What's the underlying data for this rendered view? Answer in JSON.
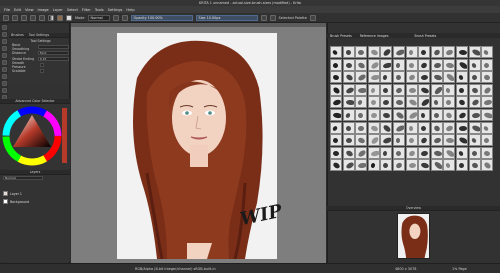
{
  "window": {
    "title": "KRITA 1 unnamed - actual-size-brush-sizes (modified) - Krita"
  },
  "menubar": {
    "items": [
      "File",
      "Edit",
      "View",
      "Image",
      "Layer",
      "Select",
      "Filter",
      "Tools",
      "Settings",
      "Help"
    ]
  },
  "toolbar": {
    "mode_label": "Mode",
    "mode_value": "Normal",
    "opacity_label": "Opacity",
    "opacity_value": "100.00%",
    "size_label": "Size",
    "size_value": "10.00px",
    "palette_label": "Selected Palette"
  },
  "tool_options": {
    "tabs": [
      "Brushes",
      "Tool Settings"
    ],
    "tab2": "Tool Settings",
    "rows": [
      {
        "label": "Basic Smoothing",
        "value": ""
      },
      {
        "label": "Distance",
        "value": "50.0"
      },
      {
        "label": "Stroke Ending",
        "value": "0.15"
      },
      {
        "label": "Smooth Pressure",
        "value": ""
      },
      {
        "label": "Scalable",
        "value": ""
      }
    ]
  },
  "advanced_color_selector": {
    "title": "Advanced Color Selector"
  },
  "layers": {
    "title": "Layers",
    "mode": "Normal",
    "items": [
      {
        "name": "Layer 1"
      },
      {
        "name": "Background"
      }
    ]
  },
  "right_dock": {
    "tabs": [
      "Brush Presets",
      "Reference Images"
    ],
    "preset_tab": "Brush Presets",
    "reference_tab": "Reference Images",
    "subtitle": "Brush Presets"
  },
  "overview": {
    "title": "Overview"
  },
  "canvas": {
    "watermark": "WIP"
  },
  "status": {
    "color_info": "RGB/Alpha (8-bit integer/channel)  sRGB-built-in",
    "dimensions": "4800 x 3078",
    "zoom": "1% Page"
  },
  "colors": {
    "panel_bg": "#323232",
    "canvas_bg": "#7e7e7e",
    "accent": "#4f6a8e",
    "hair": "#7a2e18",
    "skin": "#f2d3c2"
  }
}
